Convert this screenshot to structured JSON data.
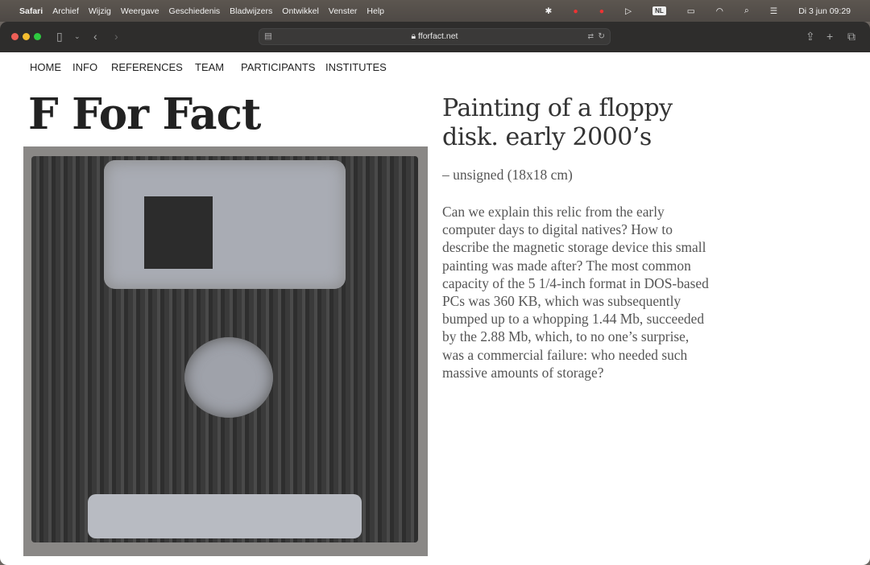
{
  "menubar": {
    "app": "Safari",
    "items": [
      "Archief",
      "Wijzig",
      "Weergave",
      "Geschiedenis",
      "Bladwijzers",
      "Ontwikkel",
      "Venster",
      "Help"
    ],
    "input_source": "NL",
    "datetime": "Di 3 jun  09:29"
  },
  "browser": {
    "url": "fforfact.net"
  },
  "site": {
    "nav": [
      "HOME",
      "INFO",
      "REFERENCES",
      "TEAM",
      "PARTICIPANTS",
      "INSTITUTES"
    ],
    "title": "F For Fact"
  },
  "artwork": {
    "title": "Painting of a floppy disk. early 2000’s",
    "subtitle": "– unsigned (18x18 cm)",
    "description": "Can we explain this relic from the early computer days to digital natives? How to describe the magnetic storage device this small painting was made after? The most common capacity of the 5 1/4-inch format in DOS-based PCs was 360 KB, which was subsequently bumped up to a whopping 1.44 Mb, succeeded by the 2.88 Mb, which, to no one’s surprise, was a commercial failure: who needed such massive amounts of storage?"
  }
}
